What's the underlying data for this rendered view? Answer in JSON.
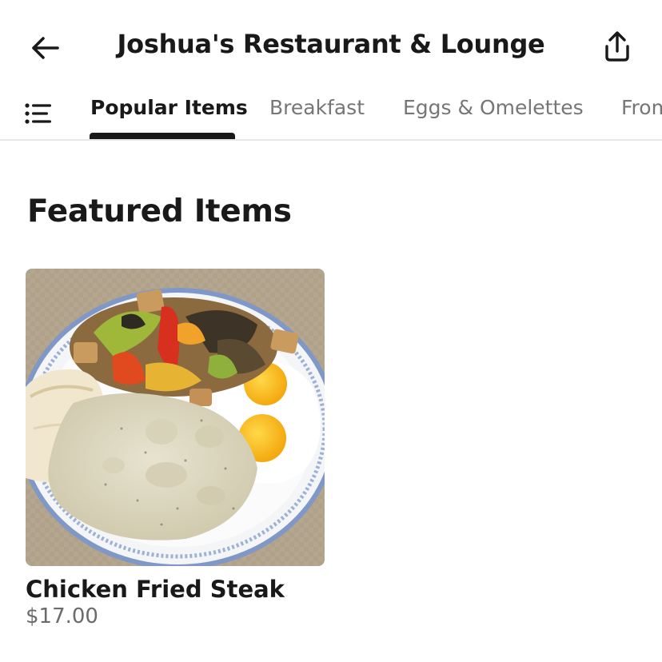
{
  "header": {
    "title": "Joshua's Restaurant & Lounge",
    "back_icon": "arrow-left-icon",
    "share_icon": "share-icon"
  },
  "tabs": {
    "menu_icon": "list-menu-icon",
    "items": [
      {
        "label": "Popular Items",
        "active": true
      },
      {
        "label": "Breakfast",
        "active": false
      },
      {
        "label": "Eggs & Omelettes",
        "active": false
      },
      {
        "label": "From",
        "active": false
      }
    ]
  },
  "featured": {
    "title": "Featured Items",
    "items": [
      {
        "name": "Chicken Fried Steak",
        "price": "$17.00",
        "image": "chicken-fried-steak-photo"
      }
    ]
  },
  "colors": {
    "text_primary": "#191919",
    "text_secondary": "#767676",
    "divider": "#e7e7e7",
    "background": "#ffffff"
  }
}
